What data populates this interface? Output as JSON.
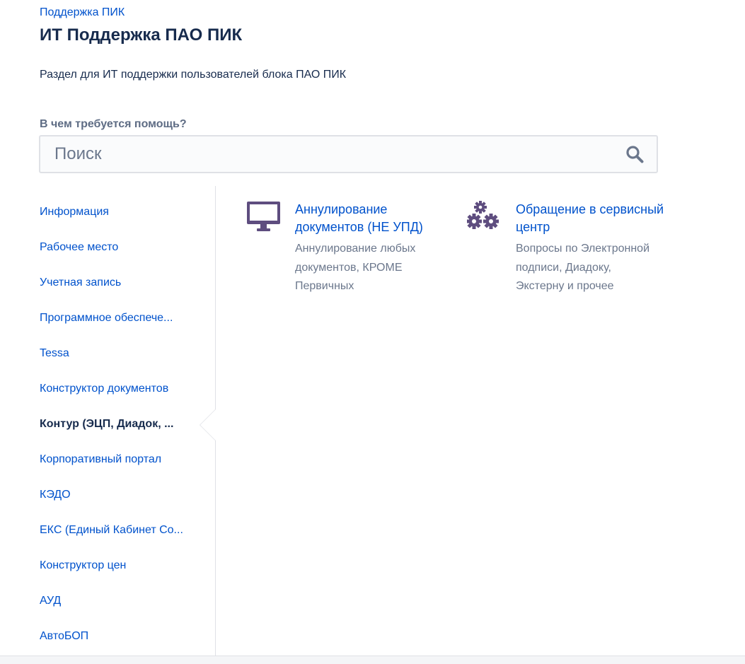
{
  "breadcrumb": "Поддержка ПИК",
  "page_title": "ИТ Поддержка ПАО ПИК",
  "description": "Раздел для ИТ поддержки пользователей блока ПАО ПИК",
  "help_label": "В чем требуется помощь?",
  "search": {
    "placeholder": "Поиск",
    "value": "",
    "icon": "search-icon"
  },
  "sidebar": {
    "items": [
      {
        "label": "Информация",
        "active": false
      },
      {
        "label": "Рабочее место",
        "active": false
      },
      {
        "label": "Учетная запись",
        "active": false
      },
      {
        "label": "Программное обеспече...",
        "active": false
      },
      {
        "label": "Tessa",
        "active": false
      },
      {
        "label": "Конструктор документов",
        "active": false
      },
      {
        "label": "Контур (ЭЦП, Диадок, ...",
        "active": true
      },
      {
        "label": "Корпоративный портал",
        "active": false
      },
      {
        "label": "КЭДО",
        "active": false
      },
      {
        "label": "ЕКС (Единый Кабинет Со...",
        "active": false
      },
      {
        "label": "Конструктор цен",
        "active": false
      },
      {
        "label": "АУД",
        "active": false
      },
      {
        "label": "АвтоБОП",
        "active": false
      }
    ]
  },
  "cards": [
    {
      "icon": "monitor-icon",
      "title": "Аннулирование документов (НЕ УПД)",
      "description": "Аннулирование любых документов, КРОМЕ Первичных"
    },
    {
      "icon": "gears-icon",
      "title": "Обращение в сервисный центр",
      "description": "Вопросы по Электронной подписи, Диадоку, Экстерну и прочее"
    }
  ],
  "colors": {
    "link": "#0052cc",
    "text": "#172b4d",
    "muted": "#6b778c",
    "icon_purple": "#5e4d7f",
    "border": "#dfe1e6"
  }
}
